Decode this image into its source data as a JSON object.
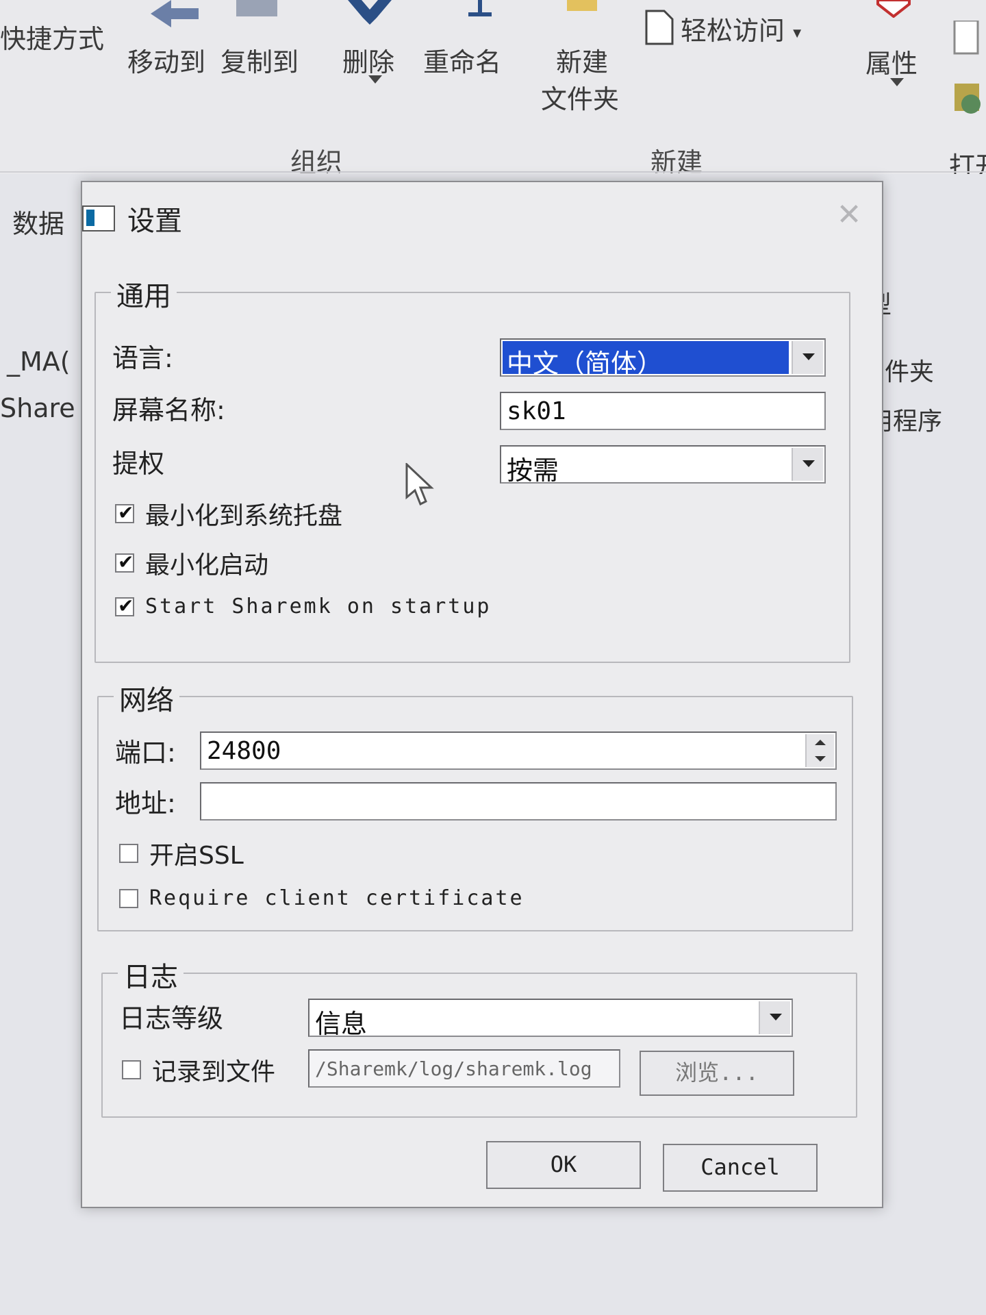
{
  "ribbon": {
    "shortcut_text": "快捷方式",
    "move_to": "移动到",
    "copy_to": "复制到",
    "delete": "删除",
    "rename": "重命名",
    "new_folder_line1": "新建",
    "new_folder_line2": "文件夹",
    "easy_access": "轻松访问",
    "properties": "属性",
    "open_partial": "打开",
    "group_organize": "组织",
    "group_new": "新建"
  },
  "background": {
    "left_text_1": "数据",
    "left_text_2": "_MA(",
    "left_text_3": "Share",
    "right_text_1": "型",
    "right_text_2": "件夹",
    "right_text_3": "用程序"
  },
  "dialog": {
    "title": "设置",
    "close_glyph": "✕",
    "general": {
      "legend": "通用",
      "language_label": "语言:",
      "language_value": "中文（简体）",
      "screen_name_label": "屏幕名称:",
      "screen_name_value": "sk01",
      "elevate_label": "提权",
      "elevate_value": "按需",
      "minimize_tray": "最小化到系统托盘",
      "minimize_start": "最小化启动",
      "start_on_startup": "Start Sharemk on startup"
    },
    "network": {
      "legend": "网络",
      "port_label": "端口:",
      "port_value": "24800",
      "address_label": "地址:",
      "address_value": "",
      "enable_ssl": "开启SSL",
      "require_cert": "Require client certificate"
    },
    "log": {
      "legend": "日志",
      "level_label": "日志等级",
      "level_value": "信息",
      "log_to_file": "记录到文件",
      "log_path": "/Sharemk/log/sharemk.log",
      "browse": "浏览..."
    },
    "ok": "OK",
    "cancel": "Cancel"
  }
}
